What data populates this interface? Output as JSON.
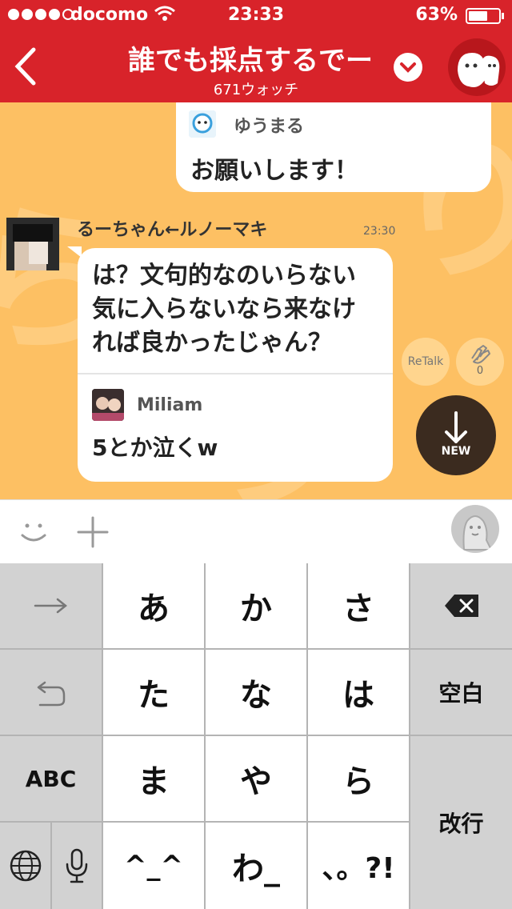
{
  "status_bar": {
    "carrier": "docomo",
    "time": "23:33",
    "battery_percent": "63%",
    "battery_level": 0.63,
    "signal_bars": 4
  },
  "header": {
    "title": "誰でも採点するでー",
    "subtitle": "671ウォッチ",
    "background_color": "#d8232a"
  },
  "chat": {
    "background_color": "#fdc063",
    "previous_message": {
      "quoted_user": "ゆうまる",
      "text": "お願いします！"
    },
    "message": {
      "sender": "るーちゃん←ルノーマキ",
      "time": "23:30",
      "text_lines": [
        "は？文句的なのいらない",
        "気に入らないなら来なけ",
        "れば良かったじゃん？"
      ],
      "quote": {
        "user": "Miliam",
        "text": "5とか泣くw"
      }
    },
    "retalk_label": "ReTalk",
    "clap_count": "0",
    "new_label": "NEW"
  },
  "input_bar": {
    "icons": [
      "smiley-icon",
      "plus-icon",
      "profile-icon"
    ]
  },
  "keyboard": {
    "left_column": [
      "→",
      "↺",
      "ABC"
    ],
    "kana_rows": [
      [
        "あ",
        "か",
        "さ"
      ],
      [
        "た",
        "な",
        "は"
      ],
      [
        "ま",
        "や",
        "ら"
      ],
      [
        "^_^",
        "わ_",
        "、。?!"
      ]
    ],
    "delete_key": "delete",
    "space_label": "空白",
    "enter_label": "改行",
    "bottom_left_icons": [
      "globe-icon",
      "mic-icon"
    ]
  }
}
